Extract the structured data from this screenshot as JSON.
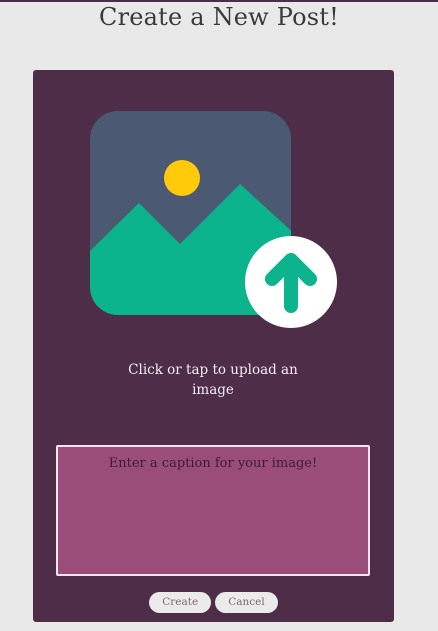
{
  "page": {
    "title": "Create a New Post!"
  },
  "upload": {
    "prompt": "Click or tap to upload an image",
    "icon": "image-upload-icon"
  },
  "caption": {
    "placeholder": "Enter a caption for your image!",
    "value": ""
  },
  "actions": {
    "create_label": "Create",
    "cancel_label": "Cancel"
  },
  "colors": {
    "background": "#e9e9e9",
    "card": "#4d2d47",
    "caption_field": "#9b4d79",
    "photo_frame": "#4b5a72",
    "mountains": "#0bb48d",
    "sun": "#ffca0a",
    "button": "#ecebeb"
  }
}
